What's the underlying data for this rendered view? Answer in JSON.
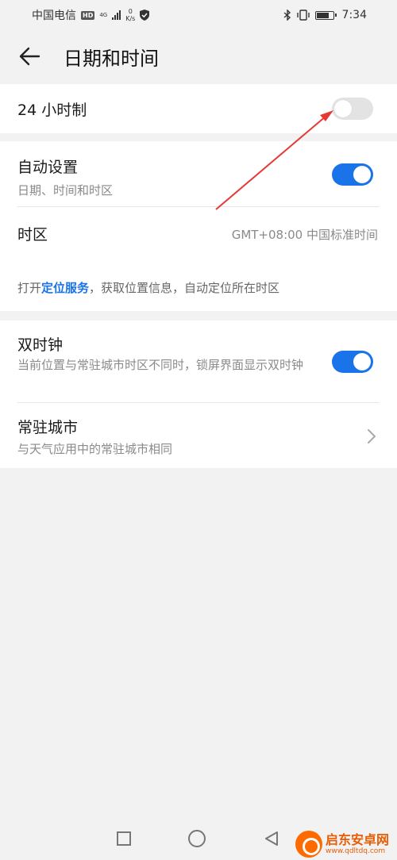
{
  "status_bar": {
    "carrier": "中国电信",
    "hd": "HD",
    "network": "4G",
    "speed_value": "0",
    "speed_unit": "K/s",
    "time": "7:34"
  },
  "header": {
    "title": "日期和时间"
  },
  "section_24h": {
    "label": "24 小时制",
    "toggle_on": false
  },
  "section_auto": {
    "auto_title": "自动设置",
    "auto_sub": "日期、时间和时区",
    "auto_on": true,
    "timezone_label": "时区",
    "timezone_value": "GMT+08:00 中国标准时间",
    "hint_prefix": "打开",
    "hint_link": "定位服务",
    "hint_suffix": "，获取位置信息，自动定位所在时区"
  },
  "section_dual": {
    "dual_title": "双时钟",
    "dual_sub": "当前位置与常驻城市时区不同时，锁屏界面显示双时钟",
    "dual_on": true,
    "city_title": "常驻城市",
    "city_sub": "与天气应用中的常驻城市相同"
  },
  "watermark": {
    "name": "启东安卓网",
    "url": "www.qdltdq.com"
  },
  "colors": {
    "accent": "#1a73e8",
    "annotation_arrow": "#e53935"
  }
}
